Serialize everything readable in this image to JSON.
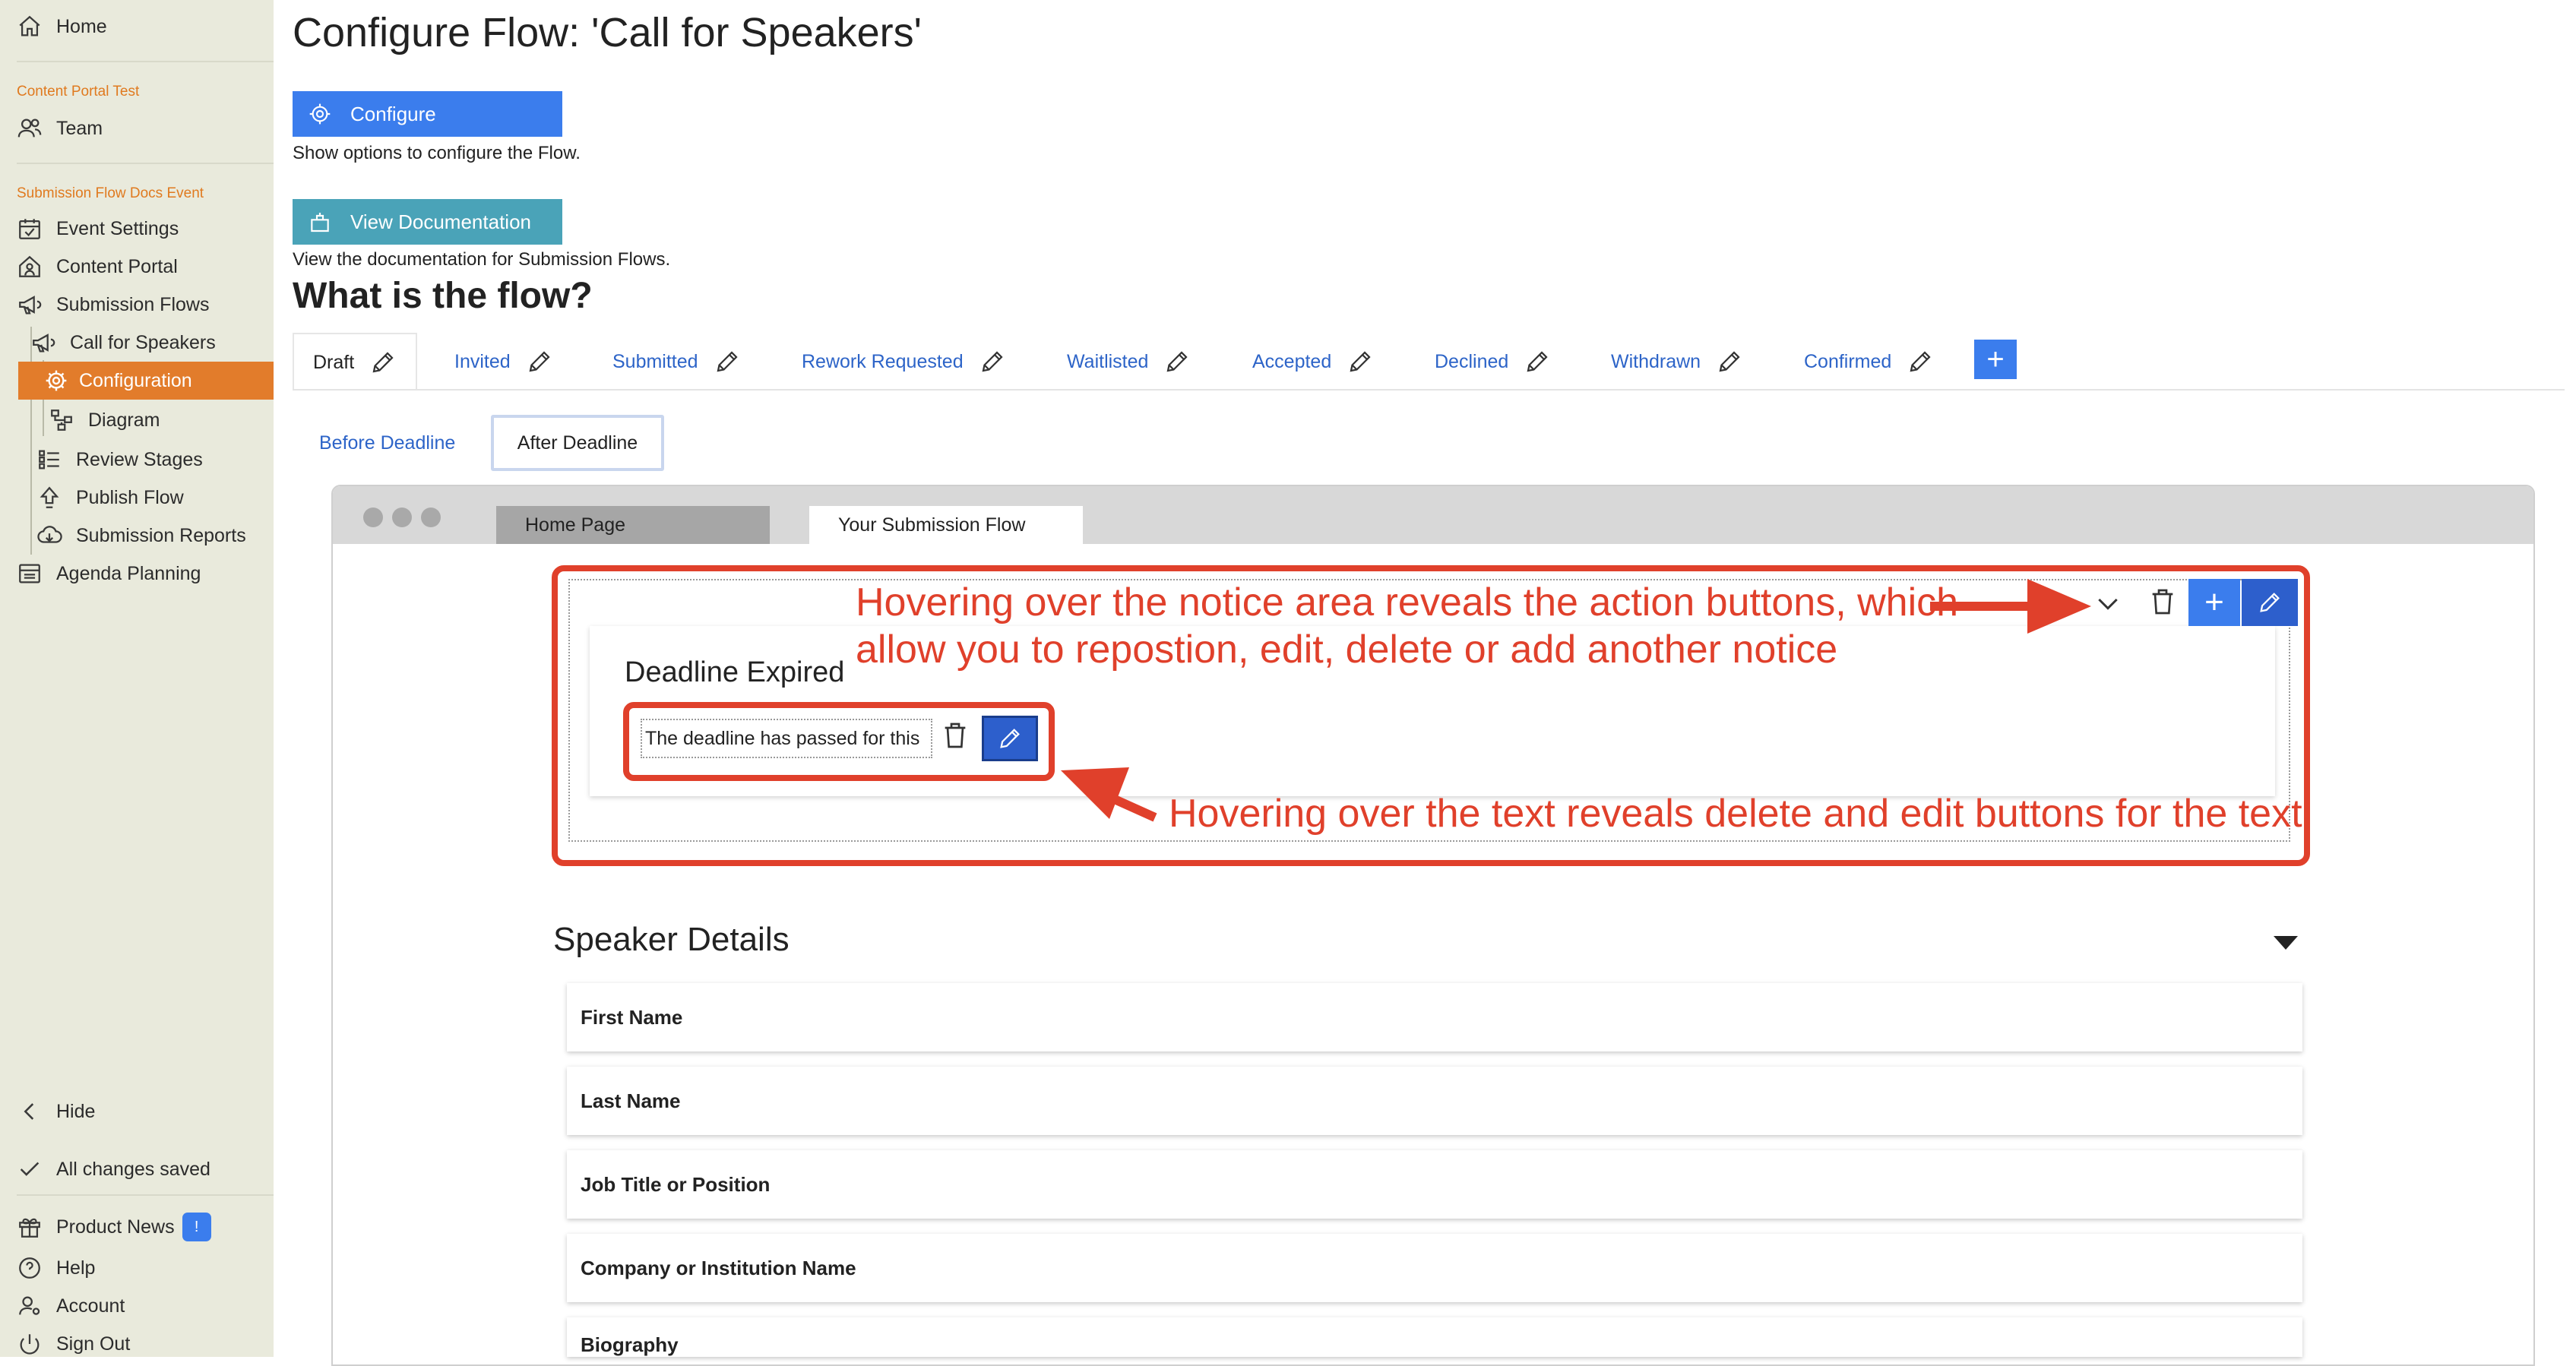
{
  "sidebar": {
    "home": "Home",
    "section_1": "Content Portal Test",
    "team": "Team",
    "section_2": "Submission Flow Docs Event",
    "event_settings": "Event Settings",
    "content_portal": "Content Portal",
    "submission_flows": "Submission Flows",
    "call_for_speakers": "Call for Speakers",
    "configuration": "Configuration",
    "diagram": "Diagram",
    "review_stages": "Review Stages",
    "publish_flow": "Publish Flow",
    "submission_reports": "Submission Reports",
    "agenda_planning": "Agenda Planning",
    "hide": "Hide",
    "saved_status": "All changes saved",
    "product_news": "Product News",
    "product_news_badge": "!",
    "help": "Help",
    "account": "Account",
    "sign_out": "Sign Out"
  },
  "header": {
    "title": "Configure Flow: 'Call for Speakers'",
    "configure_label": "Configure",
    "configure_desc": "Show options to configure the Flow.",
    "docs_label": "View Documentation",
    "docs_desc": "View the documentation for Submission Flows.",
    "flow_heading": "What is the flow?"
  },
  "state_tabs": [
    "Draft",
    "Invited",
    "Submitted",
    "Rework Requested",
    "Waitlisted",
    "Accepted",
    "Declined",
    "Withdrawn",
    "Confirmed"
  ],
  "add_state_label": "+",
  "sub_tabs": {
    "before": "Before Deadline",
    "after": "After Deadline"
  },
  "preview": {
    "tab_home": "Home Page",
    "tab_flow": "Your Submission Flow",
    "notice_title": "Deadline Expired",
    "notice_text": "The deadline has passed for this",
    "add_label": "+",
    "section_title": "Speaker Details",
    "fields": [
      "First Name",
      "Last Name",
      "Job Title or Position",
      "Company or Institution Name",
      "Biography"
    ]
  },
  "annotations": {
    "line1": "Hovering over the notice area reveals the action buttons, which",
    "line2": "allow you to repostion, edit, delete or add another notice",
    "line3": "Hovering over the text reveals delete and edit buttons for the text"
  },
  "colors": {
    "accent_blue": "#3b7ded",
    "teal_button": "#4aa3b8",
    "sidebar_active": "#e27c2b",
    "annotation_red": "#e0402b"
  },
  "icons": [
    "home-icon",
    "team-icon",
    "calendar-icon",
    "content-portal-icon",
    "megaphone-icon",
    "gear-icon",
    "diagram-icon",
    "review-stages-icon",
    "publish-icon",
    "reports-icon",
    "agenda-icon",
    "chevron-left-icon",
    "check-icon",
    "gift-icon",
    "help-icon",
    "account-icon",
    "power-icon",
    "pencil-icon",
    "trash-icon",
    "chevron-down-icon",
    "caret-down-icon",
    "docs-icon"
  ]
}
